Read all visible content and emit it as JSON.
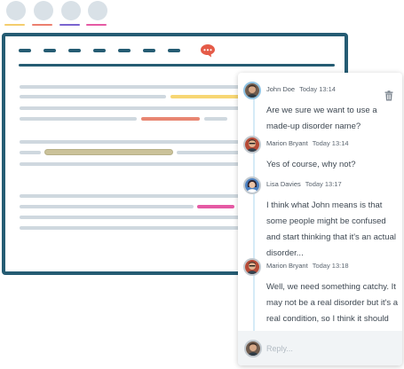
{
  "collaborators": [
    {
      "name": "avatar-1",
      "underline_color": "#f4cd6d"
    },
    {
      "name": "avatar-2",
      "underline_color": "#ec7f6f"
    },
    {
      "name": "avatar-3",
      "underline_color": "#7a64d0"
    },
    {
      "name": "avatar-4",
      "underline_color": "#e55aa4"
    }
  ],
  "colors": {
    "frame": "#255c73",
    "line": "#cfd8df",
    "highlight_yellow": "#f7d673",
    "highlight_orange": "#e88672",
    "highlight_olive": "#cbc29a",
    "highlight_pink": "#e55aa4",
    "chat_icon": "#e55b48"
  },
  "comments": [
    {
      "author": "John Doe",
      "time": "Today 13:14",
      "text": "Are we sure we want to use a made-up disorder name?",
      "has_delete": true
    },
    {
      "author": "Marion Bryant",
      "time": "Today 13:14",
      "text": "Yes of course, why not?"
    },
    {
      "author": "Lisa Davies",
      "time": "Today 13:17",
      "text": "I think what John means is that some people might be confused and start thinking that it's an actual disorder..."
    },
    {
      "author": "Marion Bryant",
      "time": "Today 13:18",
      "text": "Well, we need something catchy. It may not be a real disorder but it's a real condition, so I think it should stay."
    }
  ],
  "reply": {
    "placeholder": "Reply..."
  },
  "icons": {
    "delete": "trash-icon",
    "comments": "chat-bubble-icon"
  }
}
